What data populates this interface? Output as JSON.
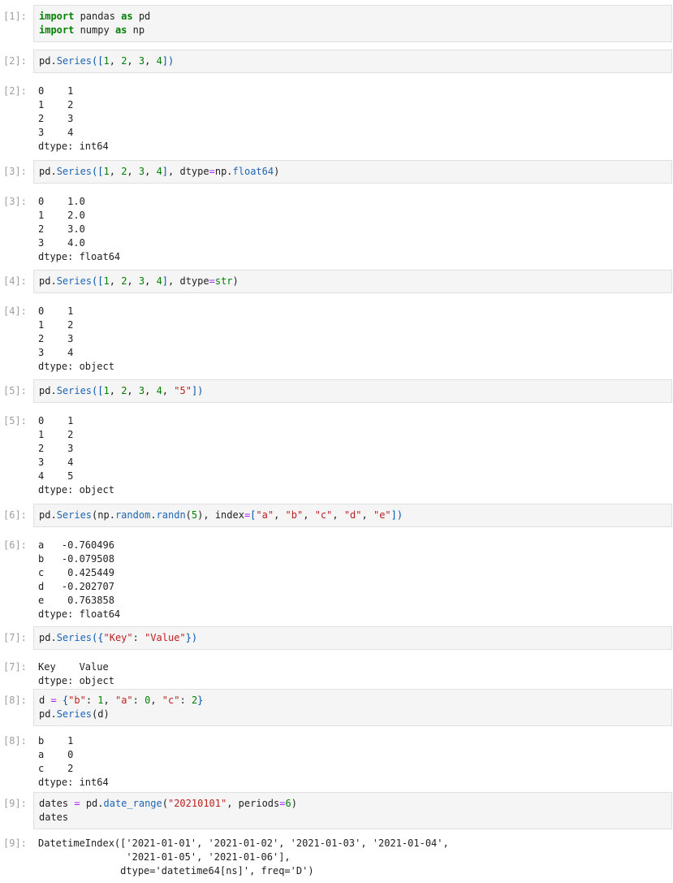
{
  "cells": [
    {
      "prompt": "[1]:",
      "input": [
        [
          {
            "t": "import",
            "c": "kw"
          },
          {
            "t": " pandas ",
            "c": "plain"
          },
          {
            "t": "as",
            "c": "kw"
          },
          {
            "t": " pd",
            "c": "plain"
          }
        ],
        [
          {
            "t": "import",
            "c": "kw"
          },
          {
            "t": " numpy ",
            "c": "plain"
          },
          {
            "t": "as",
            "c": "kw"
          },
          {
            "t": " np",
            "c": "plain"
          }
        ]
      ],
      "output": null
    },
    {
      "prompt": "[2]:",
      "input": [
        [
          {
            "t": "pd.",
            "c": "plain"
          },
          {
            "t": "Series",
            "c": "fn"
          },
          {
            "t": "([",
            "c": "br"
          },
          {
            "t": "1",
            "c": "num"
          },
          {
            "t": ", ",
            "c": "plain"
          },
          {
            "t": "2",
            "c": "num"
          },
          {
            "t": ", ",
            "c": "plain"
          },
          {
            "t": "3",
            "c": "num"
          },
          {
            "t": ", ",
            "c": "plain"
          },
          {
            "t": "4",
            "c": "num"
          },
          {
            "t": "])",
            "c": "br"
          }
        ]
      ],
      "output_prompt": "[2]:",
      "output": [
        "0    1",
        "1    2",
        "2    3",
        "3    4",
        "dtype: int64"
      ]
    },
    {
      "prompt": "[3]:",
      "input": [
        [
          {
            "t": "pd.",
            "c": "plain"
          },
          {
            "t": "Series",
            "c": "fn"
          },
          {
            "t": "([",
            "c": "br"
          },
          {
            "t": "1",
            "c": "num"
          },
          {
            "t": ", ",
            "c": "plain"
          },
          {
            "t": "2",
            "c": "num"
          },
          {
            "t": ", ",
            "c": "plain"
          },
          {
            "t": "3",
            "c": "num"
          },
          {
            "t": ", ",
            "c": "plain"
          },
          {
            "t": "4",
            "c": "num"
          },
          {
            "t": "]",
            "c": "br"
          },
          {
            "t": ", dtype",
            "c": "plain"
          },
          {
            "t": "=",
            "c": "op"
          },
          {
            "t": "np.",
            "c": "plain"
          },
          {
            "t": "float64",
            "c": "fn"
          },
          {
            "t": ")",
            "c": "plain"
          }
        ]
      ],
      "output_prompt": "[3]:",
      "output": [
        "0    1.0",
        "1    2.0",
        "2    3.0",
        "3    4.0",
        "dtype: float64"
      ]
    },
    {
      "prompt": "[4]:",
      "input": [
        [
          {
            "t": "pd.",
            "c": "plain"
          },
          {
            "t": "Series",
            "c": "fn"
          },
          {
            "t": "([",
            "c": "br"
          },
          {
            "t": "1",
            "c": "num"
          },
          {
            "t": ", ",
            "c": "plain"
          },
          {
            "t": "2",
            "c": "num"
          },
          {
            "t": ", ",
            "c": "plain"
          },
          {
            "t": "3",
            "c": "num"
          },
          {
            "t": ", ",
            "c": "plain"
          },
          {
            "t": "4",
            "c": "num"
          },
          {
            "t": "]",
            "c": "br"
          },
          {
            "t": ", dtype",
            "c": "plain"
          },
          {
            "t": "=",
            "c": "op"
          },
          {
            "t": "str",
            "c": "num"
          },
          {
            "t": ")",
            "c": "plain"
          }
        ]
      ],
      "output_prompt": "[4]:",
      "output": [
        "0    1",
        "1    2",
        "2    3",
        "3    4",
        "dtype: object"
      ]
    },
    {
      "prompt": "[5]:",
      "input": [
        [
          {
            "t": "pd.",
            "c": "plain"
          },
          {
            "t": "Series",
            "c": "fn"
          },
          {
            "t": "([",
            "c": "br"
          },
          {
            "t": "1",
            "c": "num"
          },
          {
            "t": ", ",
            "c": "plain"
          },
          {
            "t": "2",
            "c": "num"
          },
          {
            "t": ", ",
            "c": "plain"
          },
          {
            "t": "3",
            "c": "num"
          },
          {
            "t": ", ",
            "c": "plain"
          },
          {
            "t": "4",
            "c": "num"
          },
          {
            "t": ", ",
            "c": "plain"
          },
          {
            "t": "\"5\"",
            "c": "str"
          },
          {
            "t": "])",
            "c": "br"
          }
        ]
      ],
      "output_prompt": "[5]:",
      "output": [
        "0    1",
        "1    2",
        "2    3",
        "3    4",
        "4    5",
        "dtype: object"
      ]
    },
    {
      "prompt": "[6]:",
      "input": [
        [
          {
            "t": "pd.",
            "c": "plain"
          },
          {
            "t": "Series",
            "c": "fn"
          },
          {
            "t": "(np.",
            "c": "plain"
          },
          {
            "t": "random",
            "c": "fn"
          },
          {
            "t": ".",
            "c": "plain"
          },
          {
            "t": "randn",
            "c": "fn"
          },
          {
            "t": "(",
            "c": "plain"
          },
          {
            "t": "5",
            "c": "num"
          },
          {
            "t": "), index",
            "c": "plain"
          },
          {
            "t": "=",
            "c": "op"
          },
          {
            "t": "[",
            "c": "br"
          },
          {
            "t": "\"a\"",
            "c": "str"
          },
          {
            "t": ", ",
            "c": "plain"
          },
          {
            "t": "\"b\"",
            "c": "str"
          },
          {
            "t": ", ",
            "c": "plain"
          },
          {
            "t": "\"c\"",
            "c": "str"
          },
          {
            "t": ", ",
            "c": "plain"
          },
          {
            "t": "\"d\"",
            "c": "str"
          },
          {
            "t": ", ",
            "c": "plain"
          },
          {
            "t": "\"e\"",
            "c": "str"
          },
          {
            "t": "])",
            "c": "br"
          }
        ]
      ],
      "output_prompt": "[6]:",
      "output": [
        "a   -0.760496",
        "b   -0.079508",
        "c    0.425449",
        "d   -0.202707",
        "e    0.763858",
        "dtype: float64"
      ]
    },
    {
      "prompt": "[7]:",
      "input": [
        [
          {
            "t": "pd.",
            "c": "plain"
          },
          {
            "t": "Series",
            "c": "fn"
          },
          {
            "t": "({",
            "c": "br"
          },
          {
            "t": "\"Key\"",
            "c": "str"
          },
          {
            "t": ": ",
            "c": "plain"
          },
          {
            "t": "\"Value\"",
            "c": "str"
          },
          {
            "t": "})",
            "c": "br"
          }
        ]
      ],
      "output_prompt": "[7]:",
      "output": [
        "Key    Value",
        "dtype: object"
      ]
    },
    {
      "prompt": "[8]:",
      "input": [
        [
          {
            "t": "d ",
            "c": "plain"
          },
          {
            "t": "=",
            "c": "op"
          },
          {
            "t": " {",
            "c": "br"
          },
          {
            "t": "\"b\"",
            "c": "str"
          },
          {
            "t": ": ",
            "c": "plain"
          },
          {
            "t": "1",
            "c": "num"
          },
          {
            "t": ", ",
            "c": "plain"
          },
          {
            "t": "\"a\"",
            "c": "str"
          },
          {
            "t": ": ",
            "c": "plain"
          },
          {
            "t": "0",
            "c": "num"
          },
          {
            "t": ", ",
            "c": "plain"
          },
          {
            "t": "\"c\"",
            "c": "str"
          },
          {
            "t": ": ",
            "c": "plain"
          },
          {
            "t": "2",
            "c": "num"
          },
          {
            "t": "}",
            "c": "br"
          }
        ],
        [
          {
            "t": "pd.",
            "c": "plain"
          },
          {
            "t": "Series",
            "c": "fn"
          },
          {
            "t": "(d)",
            "c": "plain"
          }
        ]
      ],
      "output_prompt": "[8]:",
      "output": [
        "b    1",
        "a    0",
        "c    2",
        "dtype: int64"
      ]
    },
    {
      "prompt": "[9]:",
      "input": [
        [
          {
            "t": "dates ",
            "c": "plain"
          },
          {
            "t": "=",
            "c": "op"
          },
          {
            "t": " pd.",
            "c": "plain"
          },
          {
            "t": "date_range",
            "c": "fn"
          },
          {
            "t": "(",
            "c": "plain"
          },
          {
            "t": "\"20210101\"",
            "c": "str"
          },
          {
            "t": ", periods",
            "c": "plain"
          },
          {
            "t": "=",
            "c": "op"
          },
          {
            "t": "6",
            "c": "num"
          },
          {
            "t": ")",
            "c": "plain"
          }
        ],
        [
          {
            "t": "dates",
            "c": "plain"
          }
        ]
      ],
      "output_prompt": "[9]:",
      "output": [
        "DatetimeIndex(['2021-01-01', '2021-01-02', '2021-01-03', '2021-01-04',",
        "               '2021-01-05', '2021-01-06'],",
        "              dtype='datetime64[ns]', freq='D')"
      ]
    }
  ]
}
